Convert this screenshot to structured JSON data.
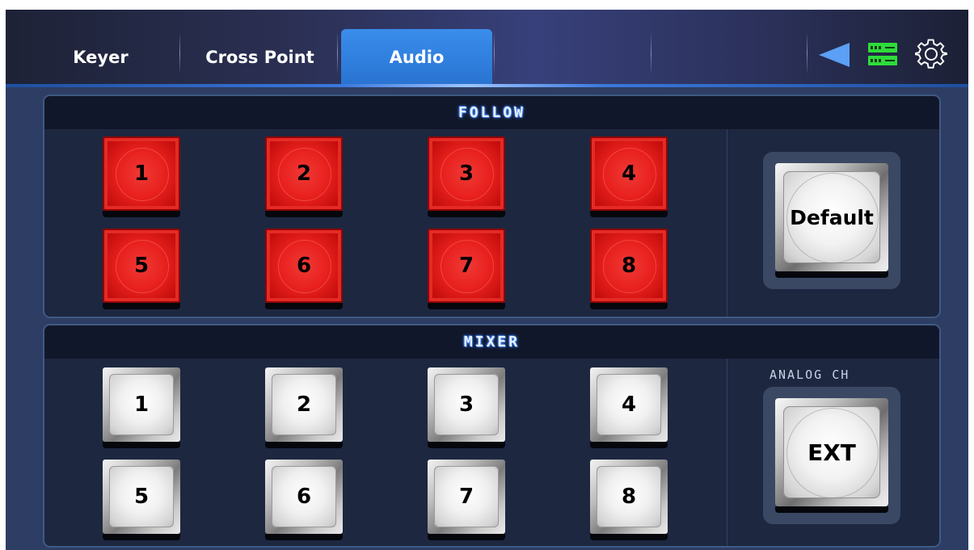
{
  "tabs": [
    {
      "label": "Keyer",
      "active": false
    },
    {
      "label": "Cross Point",
      "active": false
    },
    {
      "label": "Audio",
      "active": true
    }
  ],
  "topbar_icons": [
    "back-triangle-icon",
    "server-status-icon",
    "gear-icon"
  ],
  "colors": {
    "active_tab": "#2f7edd",
    "follow_button": "#e8201d",
    "panel_bg": "#1d2740",
    "status_icon": "#2edc3a",
    "back_icon": "#5ba0f5"
  },
  "follow": {
    "title": "FOLLOW",
    "channels": [
      "1",
      "2",
      "3",
      "4",
      "5",
      "6",
      "7",
      "8"
    ],
    "default_label": "Default"
  },
  "mixer": {
    "title": "MIXER",
    "channels": [
      "1",
      "2",
      "3",
      "4",
      "5",
      "6",
      "7",
      "8"
    ],
    "analog_label": "ANALOG CH",
    "ext_label": "EXT"
  }
}
